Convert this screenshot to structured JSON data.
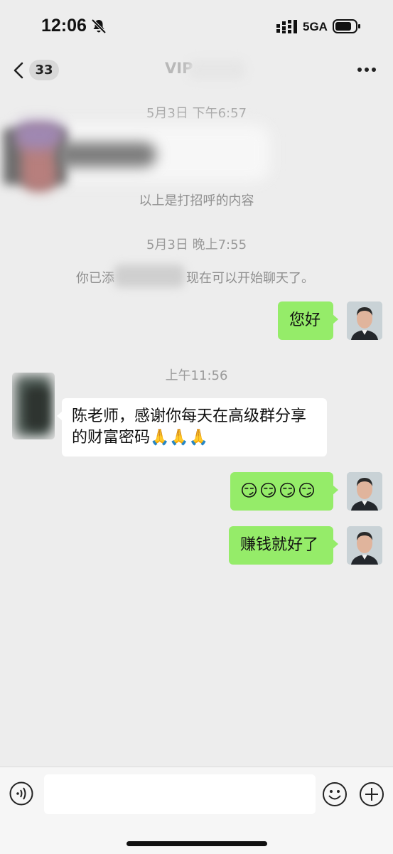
{
  "status_bar": {
    "time": "12:06",
    "network": "5GA"
  },
  "nav": {
    "unread_count": "33",
    "title": "VIP"
  },
  "messages": {
    "ts1": "5月3日 下午6:57",
    "greeting_note": "以上是打招呼的内容",
    "ts2": "5月3日 晚上7:55",
    "added_prefix": "你已添",
    "added_suffix": "现在可以开始聊天了。",
    "me1": "您好",
    "ts3": "上午11:56",
    "other1_line1": "陈老师，感谢你每天在高级群分享",
    "other1_line2": "的财富密码",
    "other1_emoji": "🙏🙏🙏",
    "me2_emoji": "😏😏😏😏",
    "me3": "赚钱就好了"
  },
  "colors": {
    "background": "#ededed",
    "my_bubble": "#95ec69",
    "other_bubble": "#ffffff"
  },
  "icons": [
    "back-chevron-icon",
    "more-icon",
    "voice-icon",
    "emoji-icon",
    "plus-icon",
    "bell-muted-icon"
  ]
}
